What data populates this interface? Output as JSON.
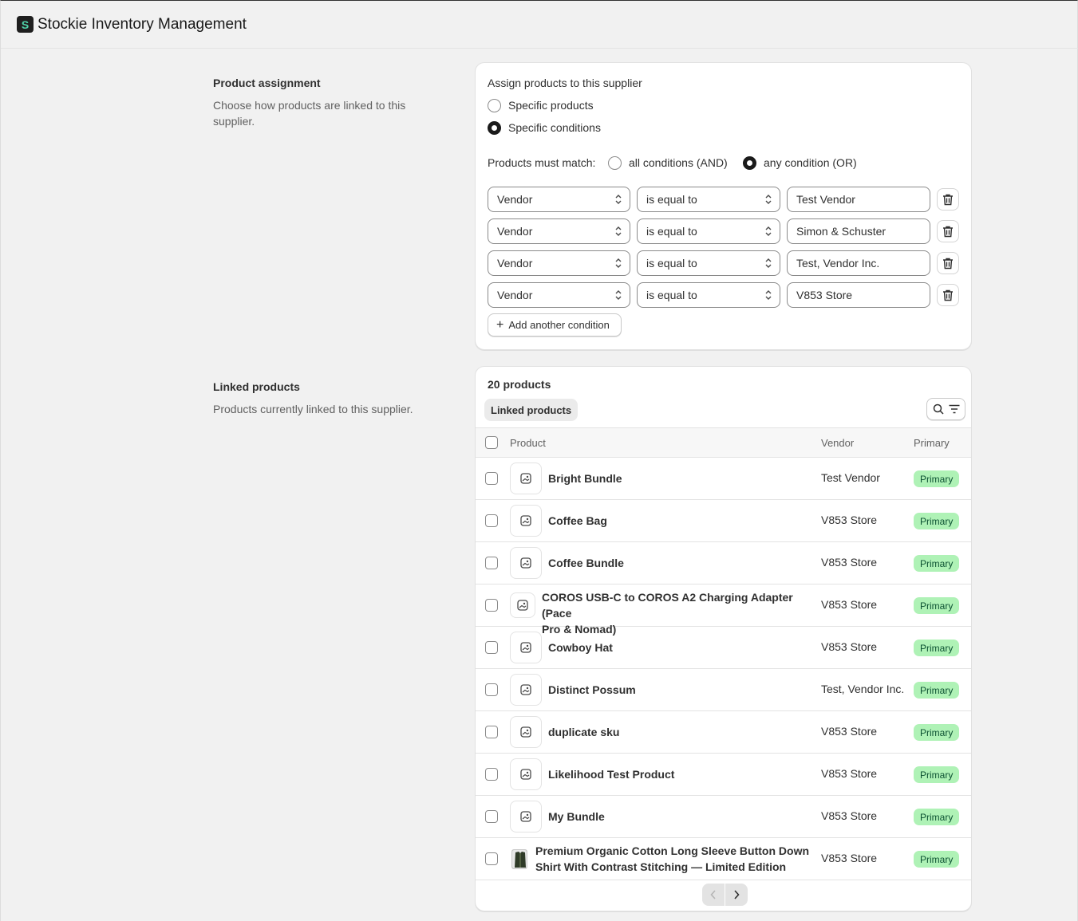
{
  "app": {
    "title": "Stockie Inventory Management",
    "logo_letter": "S"
  },
  "assignment": {
    "title": "Product assignment",
    "description": "Choose how products are linked to this supplier.",
    "assign_label": "Assign products to this supplier",
    "option_specific_products": "Specific products",
    "option_specific_conditions": "Specific conditions",
    "selected_option": "Specific conditions",
    "match_label": "Products must match:",
    "match_all": "all conditions (AND)",
    "match_any": "any condition (OR)",
    "selected_match": "any condition (OR)",
    "conditions": [
      {
        "field": "Vendor",
        "operator": "is equal to",
        "value": "Test Vendor"
      },
      {
        "field": "Vendor",
        "operator": "is equal to",
        "value": "Simon & Schuster"
      },
      {
        "field": "Vendor",
        "operator": "is equal to",
        "value": "Test, Vendor Inc."
      },
      {
        "field": "Vendor",
        "operator": "is equal to",
        "value": "V853 Store"
      }
    ],
    "add_condition_label": "Add another condition"
  },
  "linked": {
    "title": "Linked products",
    "description": "Products currently linked to this supplier.",
    "count_label": "20 products",
    "tab_label": "Linked products",
    "columns": {
      "product": "Product",
      "vendor": "Vendor",
      "primary": "Primary"
    },
    "rows": [
      {
        "name": "Bright Bundle",
        "vendor": "Test Vendor",
        "badge": "Primary"
      },
      {
        "name": "Coffee Bag",
        "vendor": "V853 Store",
        "badge": "Primary"
      },
      {
        "name": "Coffee Bundle",
        "vendor": "V853 Store",
        "badge": "Primary"
      },
      {
        "name_line1": "COROS USB-C to COROS A2 Charging Adapter (Pace",
        "name_line2": "Pro & Nomad)",
        "vendor": "V853 Store",
        "badge": "Primary"
      },
      {
        "name": "Cowboy Hat",
        "vendor": "V853 Store",
        "badge": "Primary"
      },
      {
        "name": "Distinct Possum",
        "vendor": "Test, Vendor Inc.",
        "badge": "Primary"
      },
      {
        "name": "duplicate sku",
        "vendor": "V853 Store",
        "badge": "Primary"
      },
      {
        "name": "Likelihood Test Product",
        "vendor": "V853 Store",
        "badge": "Primary"
      },
      {
        "name": "My Bundle",
        "vendor": "V853 Store",
        "badge": "Primary"
      },
      {
        "name_line1": "Premium Organic Cotton Long Sleeve Button Down",
        "name_line2": "Shirt With Contrast Stitching — Limited Edition",
        "vendor": "V853 Store",
        "badge": "Primary"
      }
    ]
  },
  "colors": {
    "badge_bg": "#aff2b6",
    "badge_text": "#0c5132",
    "logo_accent": "#4fd1a8"
  },
  "icons": [
    "image-placeholder-icon",
    "trash-icon",
    "search-icon",
    "filter-icon",
    "chevron-left-icon",
    "chevron-right-icon",
    "select-chevron-icon",
    "plus-icon"
  ]
}
